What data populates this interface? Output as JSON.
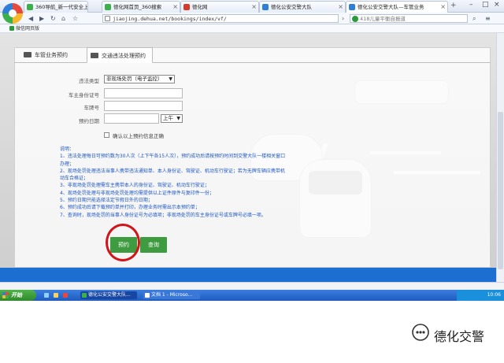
{
  "browser": {
    "tabs": [
      {
        "label": "360导航_新一代安全上网导航",
        "color": "#3bb04b"
      },
      {
        "label": "德化网首页_360搜索",
        "color": "#3bb04b"
      },
      {
        "label": "德化网",
        "color": "#d83a2a"
      },
      {
        "label": "德化公安交警大队",
        "color": "#2f7fd8"
      },
      {
        "label": "德化公安交警大队—车管业务",
        "color": "#2f7fd8"
      }
    ],
    "address": "jiaojing.dehua.net/bookings/index/vf/",
    "search_placeholder": "418儿童平衡自报道",
    "bookmark": "微信网页版"
  },
  "form": {
    "tabs": [
      "车管业务预约",
      "交通违法处理预约"
    ],
    "violation_type_label": "违法类型",
    "violation_type_value": "非现场处罚（电子监控）",
    "id_label": "车主身份证号",
    "plate_label": "车牌号",
    "date_label": "预约日期",
    "period_value": "上午",
    "confirm_label": "确认以上预约信息正确"
  },
  "notes": [
    "说明：",
    "1、违法处理每日可预约数为30人次（上下午各15人次），预约成功后请按预约时间到交警大队一楼相关窗口办理；",
    "2、现场处罚处理违法当事人携带违法通知单、本人身份证、驾驶证、机动车行驶证；若为无牌车辆应携带机动车合格证；",
    "3、非现场处罚处理需车主携带本人的身份证、驾驶证、机动车行驶证；",
    "4、现场处罚处理与非现场处罚处理均需提供以上证件原件与复印件一份；",
    "5、预约日期只能选择法定节假日外的日期；",
    "6、预约成功后请下载预约单并打印，办理业务时需出示本预约单；",
    "7、查询时，现场处罚的当事人身份证号为必填项；非现场处罚的车主身份证号或车牌号必填一项。"
  ],
  "buttons": {
    "book": "预约",
    "query": "查询"
  },
  "taskbar": {
    "start": "开始",
    "items": [
      "德化公安交警大队...",
      "文档 1 - Microso..."
    ],
    "clock": "10:06"
  },
  "watermark": "德化交警"
}
